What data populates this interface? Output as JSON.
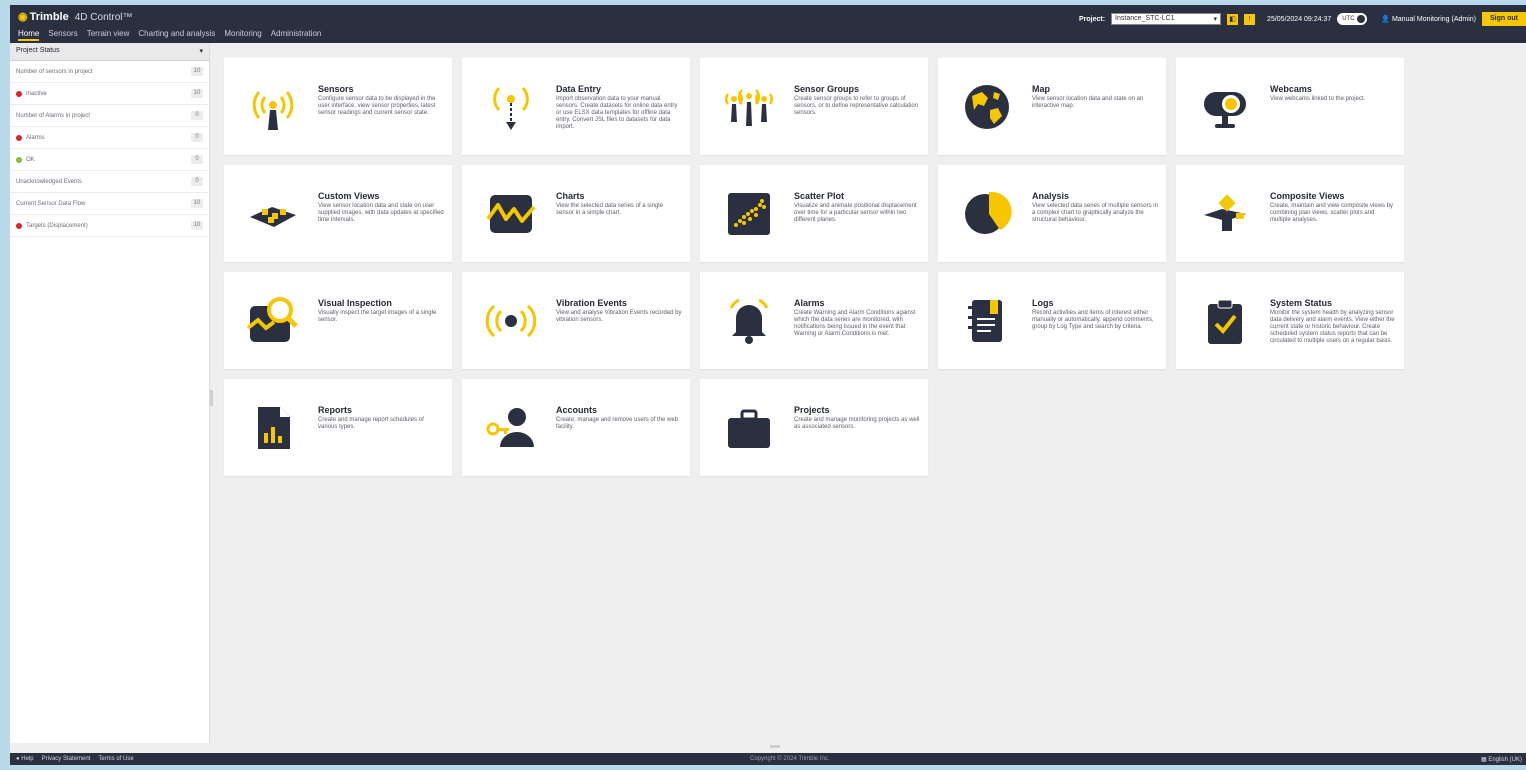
{
  "header": {
    "brand": "Trimble",
    "product": "4D Control™",
    "nav": [
      "Home",
      "Sensors",
      "Terrain view",
      "Charting and analysis",
      "Monitoring",
      "Administration"
    ],
    "project_label": "Project:",
    "project_value": "Instance_STC-LC1",
    "btn_a": "◧",
    "btn_b": "!",
    "datetime": "25/05/2024 09:24:37",
    "toggle_label": "UTC",
    "user": "Manual Monitoring (Admin)",
    "signout": "Sign out"
  },
  "sidebar": {
    "title": "Project Status",
    "items": [
      {
        "label": "Number of sensors in project",
        "count": "10",
        "dot": ""
      },
      {
        "label": "Inactive",
        "count": "10",
        "dot": "red"
      },
      {
        "label": "Number of Alarms in project",
        "count": "0",
        "dot": ""
      },
      {
        "label": "Alarms",
        "count": "0",
        "dot": "red"
      },
      {
        "label": "OK",
        "count": "0",
        "dot": "green"
      },
      {
        "label": "Unacknowledged Events",
        "count": "0",
        "dot": ""
      },
      {
        "label": "Current Sensor Data Flow",
        "count": "10",
        "dot": ""
      },
      {
        "label": "Targets (Displacement)",
        "count": "10",
        "dot": "red"
      }
    ]
  },
  "cards": [
    {
      "title": "Sensors",
      "desc": "Configure sensor data to be displayed in the user interface, view sensor properties, latest sensor readings and current sensor state.",
      "icon": "antenna-signal-icon"
    },
    {
      "title": "Data Entry",
      "desc": "Import observation data to your manual sensors. Create datasets for online data entry or use ELSX data templates for offline data entry. Convert JSL files to datasets for data import.",
      "icon": "data-entry-icon"
    },
    {
      "title": "Sensor Groups",
      "desc": "Create sensor groups to refer to groups of sensors, or to define representative calculation sensors.",
      "icon": "sensor-groups-icon"
    },
    {
      "title": "Map",
      "desc": "View sensor location data and state on an interactive map.",
      "icon": "globe-icon"
    },
    {
      "title": "Webcams",
      "desc": "View webcams linked to the project.",
      "icon": "webcam-icon"
    },
    {
      "title": "Custom Views",
      "desc": "View sensor location data and state on user supplied images, with data updates at specified time intervals.",
      "icon": "custom-views-icon"
    },
    {
      "title": "Charts",
      "desc": "View the selected data series of a single sensor in a simple chart.",
      "icon": "chart-icon"
    },
    {
      "title": "Scatter Plot",
      "desc": "Visualize and animate positional displacement over time for a particular sensor within two different planes.",
      "icon": "scatter-plot-icon"
    },
    {
      "title": "Analysis",
      "desc": "View selected data series of multiple sensors in a complex chart to graphically analyze the structural behaviour.",
      "icon": "pie-chart-icon"
    },
    {
      "title": "Composite Views",
      "desc": "Create, maintain and view composite views by combining plan views, scatter plots and multiple analyses.",
      "icon": "composite-views-icon"
    },
    {
      "title": "Visual Inspection",
      "desc": "Visually inspect the target images of a single sensor.",
      "icon": "visual-inspection-icon"
    },
    {
      "title": "Vibration Events",
      "desc": "View and analyse Vibration Events recorded by vibration sensors.",
      "icon": "vibration-icon"
    },
    {
      "title": "Alarms",
      "desc": "Create Warning and Alarm Conditions against which the data series are monitored, with notifications being issued in the event that Warning or Alarm Conditions is met.",
      "icon": "bell-icon"
    },
    {
      "title": "Logs",
      "desc": "Record activities and items of interest either manually or automatically, append comments, group by Log Type and search by criteria.",
      "icon": "logbook-icon"
    },
    {
      "title": "System Status",
      "desc": "Monitor the system health by analyzing sensor data delivery and alarm events. View either the current state or historic behaviour. Create scheduled system status reports that can be circulated to multiple users on a regular basis.",
      "icon": "clipboard-check-icon"
    },
    {
      "title": "Reports",
      "desc": "Create and manage report schedules of various types.",
      "icon": "report-icon"
    },
    {
      "title": "Accounts",
      "desc": "Create, manage and remove users of the web facility.",
      "icon": "accounts-icon"
    },
    {
      "title": "Projects",
      "desc": "Create and manage monitoring projects as well as associated sensors.",
      "icon": "briefcase-icon"
    }
  ],
  "footer": {
    "help": "Help",
    "privacy": "Privacy Statement",
    "terms": "Terms of Use",
    "copyright": "Copyright © 2024 Trimble Inc.",
    "language": "English (UK)"
  },
  "colors": {
    "accent": "#f6c600",
    "dark": "#2b3040",
    "alarm": "#d6262c",
    "ok": "#8db93b"
  }
}
